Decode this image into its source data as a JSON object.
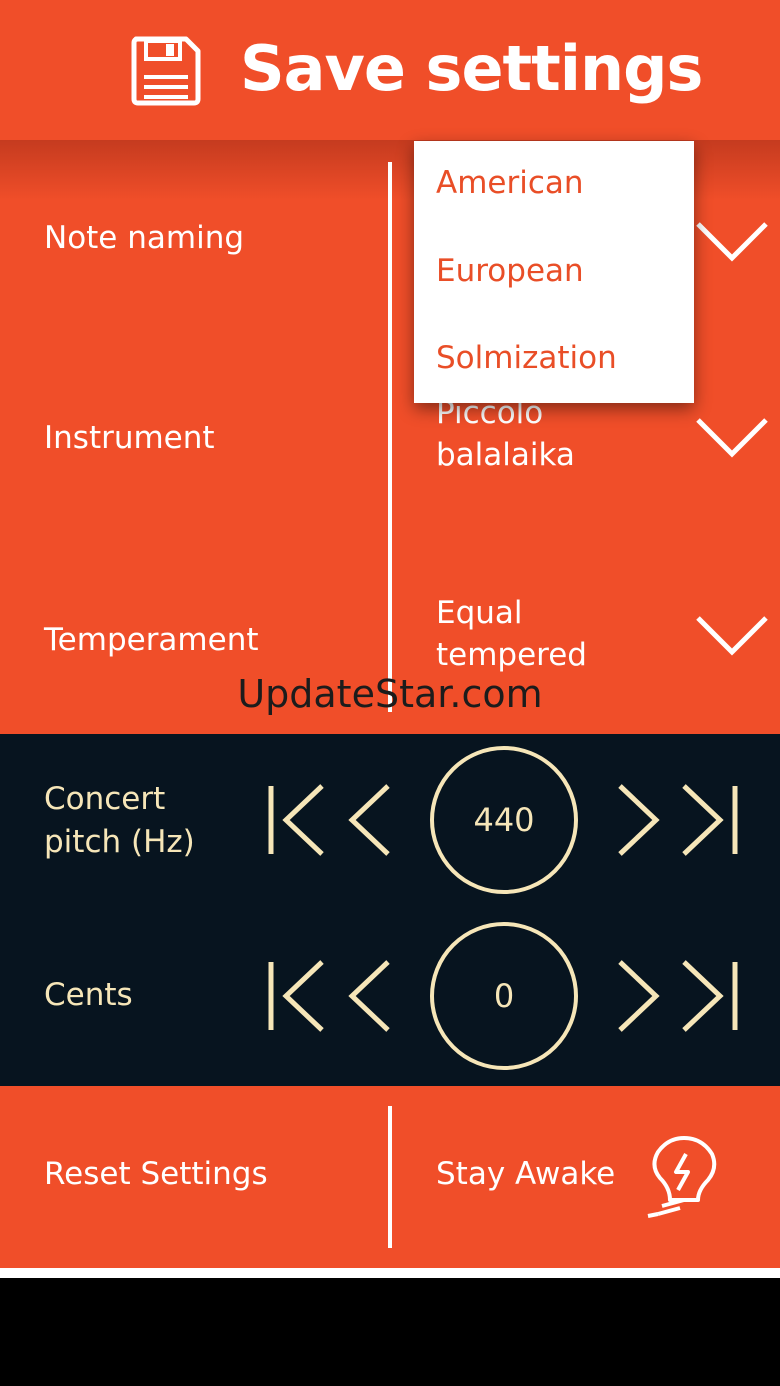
{
  "header": {
    "title": "Save settings",
    "icon": "floppy-disk-icon"
  },
  "settings": {
    "note_naming": {
      "label": "Note naming"
    },
    "instrument": {
      "label": "Instrument",
      "value_line1": "Piccolo",
      "value_line2": "balalaika"
    },
    "temperament": {
      "label": "Temperament",
      "value_line1": "Equal",
      "value_line2": "tempered"
    },
    "dropdown_options": [
      "American",
      "European",
      "Solmization"
    ]
  },
  "tuning": {
    "concert_pitch": {
      "label_line1": "Concert",
      "label_line2": "pitch (Hz)",
      "value": "440"
    },
    "cents": {
      "label": "Cents",
      "value": "0"
    }
  },
  "footer": {
    "reset_label": "Reset Settings",
    "stay_awake_label": "Stay Awake",
    "stay_awake_icon": "lightbulb-icon"
  },
  "watermark": "UpdateStar.com",
  "colors": {
    "accent": "#f04e29",
    "dark": "#07141f",
    "cream": "#f6e6b8",
    "dropdown_text": "#e94e27"
  }
}
